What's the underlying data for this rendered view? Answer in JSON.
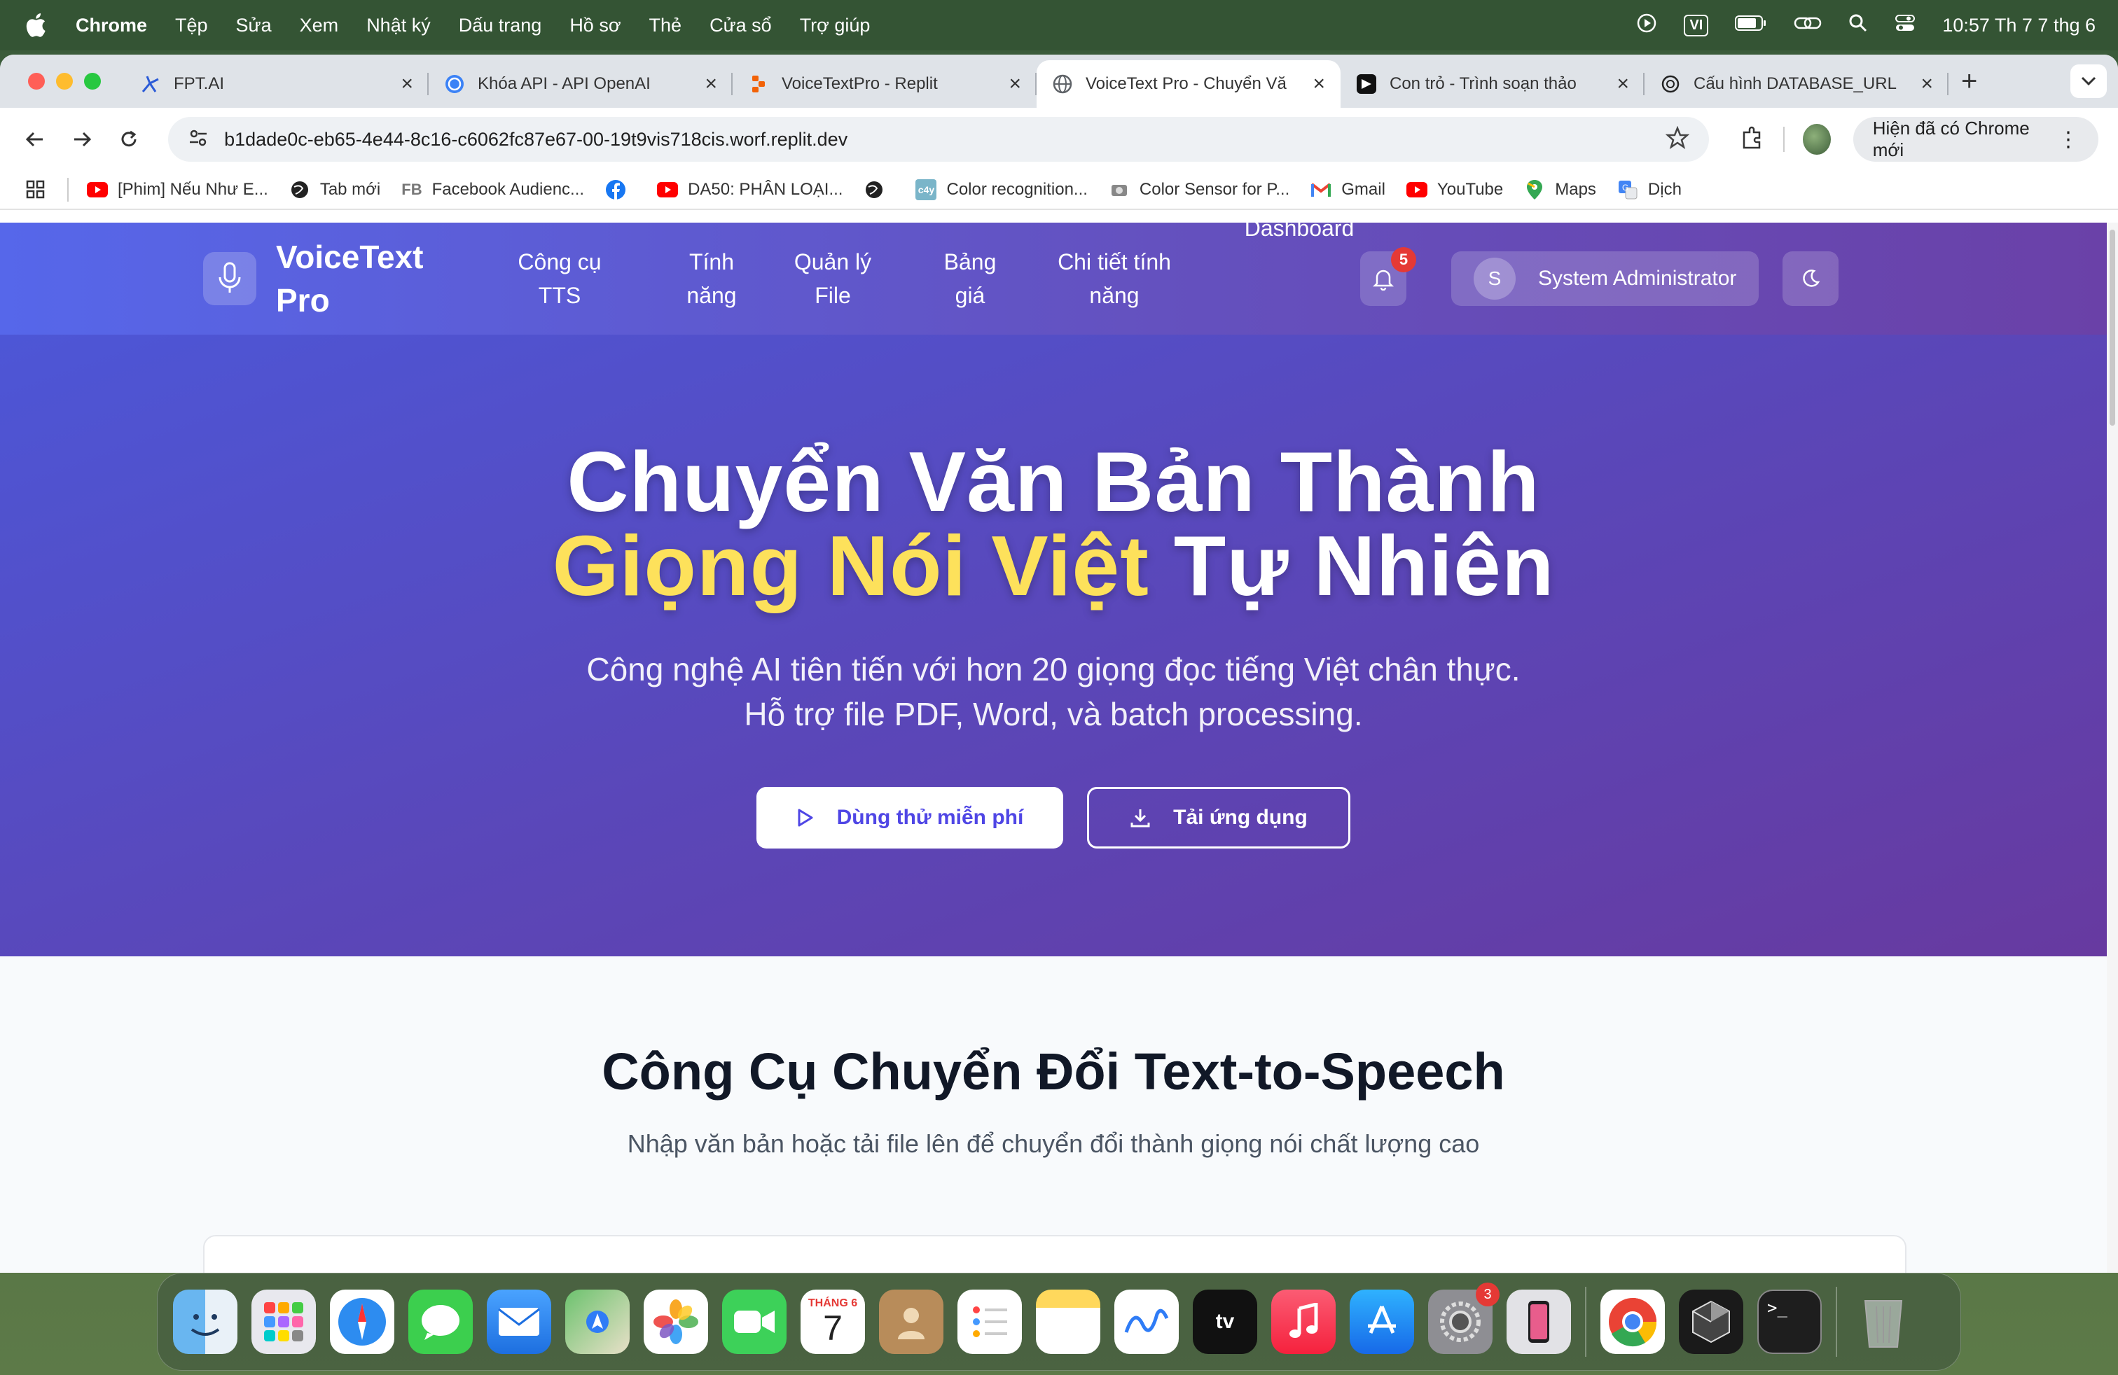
{
  "menubar": {
    "app_name": "Chrome",
    "items": [
      "Tệp",
      "Sửa",
      "Xem",
      "Nhật ký",
      "Dấu trang",
      "Hồ sơ",
      "Thẻ",
      "Cửa sổ",
      "Trợ giúp"
    ],
    "input_method": "VI",
    "clock": "10:57 Th 7 7 thg 6"
  },
  "tabs": [
    {
      "title": "FPT.AI",
      "icon": "fpt-ai-icon"
    },
    {
      "title": "Khóa API - API OpenAI",
      "icon": "openai-icon"
    },
    {
      "title": "VoiceTextPro - Replit",
      "icon": "replit-icon"
    },
    {
      "title": "VoiceText Pro - Chuyển Vă",
      "icon": "globe-icon",
      "active": true
    },
    {
      "title": "Con trỏ - Trình soạn thảo",
      "icon": "cursor-icon"
    },
    {
      "title": "Cấu hình DATABASE_URL",
      "icon": "openai-icon"
    }
  ],
  "toolbar": {
    "url": "b1dade0c-eb65-4e44-8c16-c6062fc87e67-00-19t9vis718cis.worf.replit.dev",
    "chrome_new": "Hiện đã có Chrome mới"
  },
  "bookmarks": [
    {
      "label": "[Phim] Nếu Như E...",
      "icon": "youtube-icon"
    },
    {
      "label": "Tab mới",
      "icon": "globe-icon"
    },
    {
      "label": "Facebook Audienc...",
      "icon": "fb-text-icon"
    },
    {
      "label": "",
      "icon": "facebook-icon"
    },
    {
      "label": "DA50: PHÂN LOẠI...",
      "icon": "youtube-icon"
    },
    {
      "label": "",
      "icon": "globe-icon"
    },
    {
      "label": "Color recognition...",
      "icon": "c4y-icon"
    },
    {
      "label": "Color Sensor for P...",
      "icon": "sensor-icon"
    },
    {
      "label": "Gmail",
      "icon": "gmail-icon"
    },
    {
      "label": "YouTube",
      "icon": "youtube-icon"
    },
    {
      "label": "Maps",
      "icon": "maps-icon"
    },
    {
      "label": "Dịch",
      "icon": "translate-icon"
    }
  ],
  "site": {
    "brand": "VoiceText Pro",
    "nav": [
      "Công cụ TTS",
      "Tính năng",
      "Quản lý File",
      "Bảng giá",
      "Chi tiết tính năng",
      "Dashboard"
    ],
    "notifications": "5",
    "user_initial": "S",
    "user_name": "System Administrator"
  },
  "hero": {
    "title_line1": "Chuyển Văn Bản Thành",
    "title_accent": "Giọng Nói Việt",
    "title_rest": "Tự Nhiên",
    "subtitle_line1": "Công nghệ AI tiên tiến với hơn 20 giọng đọc tiếng Việt chân thực.",
    "subtitle_line2": "Hỗ trợ file PDF, Word, và batch processing.",
    "primary_cta": "Dùng thử miễn phí",
    "secondary_cta": "Tải ứng dụng"
  },
  "tools": {
    "heading": "Công Cụ Chuyển Đổi Text-to-Speech",
    "description": "Nhập văn bản hoặc tải file lên để chuyển đổi thành giọng nói chất lượng cao"
  },
  "dock": {
    "calendar_month": "THÁNG 6",
    "calendar_day": "7",
    "settings_badge": "3",
    "apps": [
      "finder",
      "launchpad",
      "safari",
      "messages",
      "mail",
      "maps",
      "photos",
      "facetime",
      "calendar",
      "contacts",
      "reminders",
      "notes",
      "freeform",
      "tv",
      "music",
      "app-store",
      "system-settings",
      "iphone-mirroring",
      "chrome",
      "cursor",
      "terminal",
      "trash"
    ]
  },
  "colors": {
    "header_start": "#5667ea",
    "header_end": "#6a41a8",
    "accent_yellow": "#fde15b",
    "primary_text": "#4f46e5"
  }
}
